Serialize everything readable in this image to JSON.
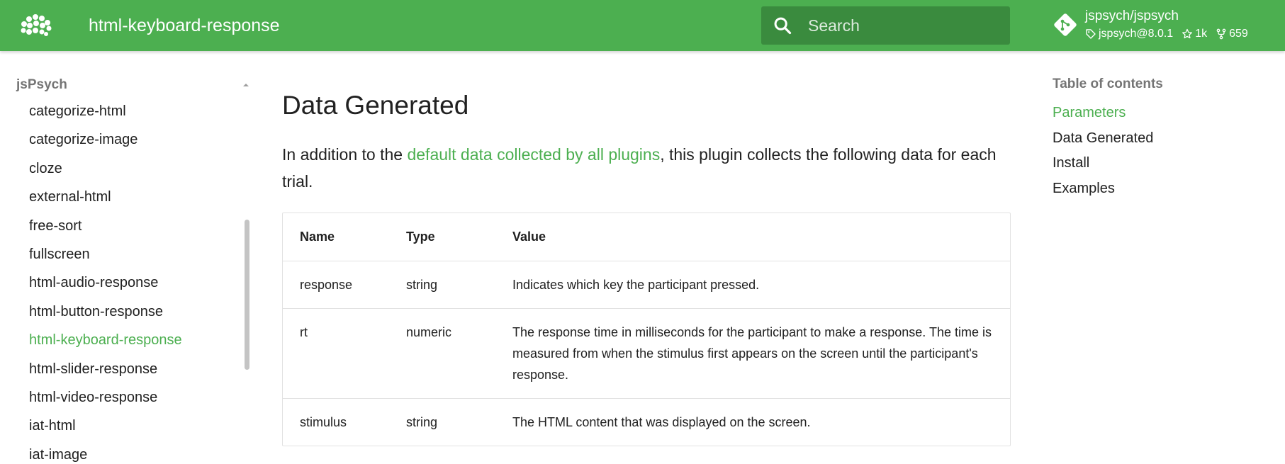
{
  "colors": {
    "primary": "#4caf50",
    "search_bg": "#3a8b3e",
    "text": "#212121",
    "muted": "#757575",
    "border": "#e2e2e2"
  },
  "header": {
    "title": "html-keyboard-response",
    "logo_icon": "brain-logo-icon",
    "search": {
      "placeholder": "Search",
      "value": ""
    },
    "repo": {
      "name": "jspsych/jspsych",
      "version": "jspsych@8.0.1",
      "stars": "1k",
      "forks": "659"
    }
  },
  "sidebar": {
    "title": "jsPsych",
    "items": [
      {
        "label": "categorize-html"
      },
      {
        "label": "categorize-image"
      },
      {
        "label": "cloze"
      },
      {
        "label": "external-html"
      },
      {
        "label": "free-sort"
      },
      {
        "label": "fullscreen"
      },
      {
        "label": "html-audio-response"
      },
      {
        "label": "html-button-response"
      },
      {
        "label": "html-keyboard-response",
        "active": true
      },
      {
        "label": "html-slider-response"
      },
      {
        "label": "html-video-response"
      },
      {
        "label": "iat-html"
      },
      {
        "label": "iat-image"
      }
    ]
  },
  "main": {
    "heading": "Data Generated",
    "intro_before": "In addition to the ",
    "intro_link": "default data collected by all plugins",
    "intro_after": ", this plugin collects the following data for each trial.",
    "table": {
      "headers": [
        "Name",
        "Type",
        "Value"
      ],
      "rows": [
        [
          "response",
          "string",
          "Indicates which key the participant pressed."
        ],
        [
          "rt",
          "numeric",
          "The response time in milliseconds for the participant to make a response. The time is measured from when the stimulus first appears on the screen until the participant's response."
        ],
        [
          "stimulus",
          "string",
          "The HTML content that was displayed on the screen."
        ]
      ]
    }
  },
  "toc": {
    "title": "Table of contents",
    "items": [
      {
        "label": "Parameters",
        "active": true
      },
      {
        "label": "Data Generated"
      },
      {
        "label": "Install"
      },
      {
        "label": "Examples"
      }
    ]
  }
}
